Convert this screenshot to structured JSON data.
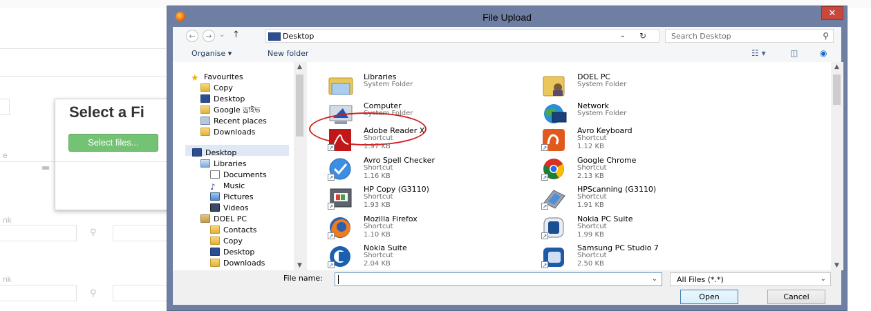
{
  "background": {
    "modal_title": "Select a Fi",
    "select_button": "Select files...",
    "side_labels": [
      "e",
      "nk",
      "nk"
    ]
  },
  "dialog": {
    "title": "File Upload",
    "close_glyph": "✕",
    "address": {
      "location": "Desktop"
    },
    "search": {
      "placeholder": "Search Desktop"
    },
    "toolbar": {
      "organise": "Organise ▾",
      "new_folder": "New folder"
    },
    "nav_tree": [
      {
        "label": "Favourites",
        "icon": "star-icon"
      },
      {
        "label": "Copy",
        "icon": "folder-icon"
      },
      {
        "label": "Desktop",
        "icon": "desktop-icon"
      },
      {
        "label": "Google ড্রাইভ",
        "icon": "drive-folder-icon"
      },
      {
        "label": "Recent places",
        "icon": "recent-places-icon"
      },
      {
        "label": "Downloads",
        "icon": "downloads-icon"
      },
      {
        "label": "Desktop",
        "icon": "desktop-icon"
      },
      {
        "label": "Libraries",
        "icon": "libraries-icon"
      },
      {
        "label": "Documents",
        "icon": "documents-icon"
      },
      {
        "label": "Music",
        "icon": "music-icon"
      },
      {
        "label": "Pictures",
        "icon": "pictures-icon"
      },
      {
        "label": "Videos",
        "icon": "videos-icon"
      },
      {
        "label": "DOEL PC",
        "icon": "user-folder-icon"
      },
      {
        "label": "Contacts",
        "icon": "contacts-icon"
      },
      {
        "label": "Copy",
        "icon": "folder-icon"
      },
      {
        "label": "Desktop",
        "icon": "desktop-icon"
      },
      {
        "label": "Downloads",
        "icon": "downloads-icon"
      }
    ],
    "files": [
      {
        "name": "Libraries",
        "type": "System Folder",
        "size": ""
      },
      {
        "name": "DOEL PC",
        "type": "System Folder",
        "size": ""
      },
      {
        "name": "Computer",
        "type": "System Folder",
        "size": ""
      },
      {
        "name": "Network",
        "type": "System Folder",
        "size": ""
      },
      {
        "name": "Adobe Reader X",
        "type": "Shortcut",
        "size": "1.97 KB"
      },
      {
        "name": "Avro Keyboard",
        "type": "Shortcut",
        "size": "1.12 KB"
      },
      {
        "name": "Avro Spell Checker",
        "type": "Shortcut",
        "size": "1.16 KB"
      },
      {
        "name": "Google Chrome",
        "type": "Shortcut",
        "size": "2.13 KB"
      },
      {
        "name": "HP Copy (G3110)",
        "type": "Shortcut",
        "size": "1.93 KB"
      },
      {
        "name": "HPScanning (G3110)",
        "type": "Shortcut",
        "size": "1.91 KB"
      },
      {
        "name": "Mozilla Firefox",
        "type": "Shortcut",
        "size": "1.10 KB"
      },
      {
        "name": "Nokia PC Suite",
        "type": "Shortcut",
        "size": "1.99 KB"
      },
      {
        "name": "Nokia Suite",
        "type": "Shortcut",
        "size": "2.04 KB"
      },
      {
        "name": "Samsung PC Studio 7",
        "type": "Shortcut",
        "size": "2.50 KB"
      }
    ],
    "file_name": {
      "label": "File name:",
      "value": ""
    },
    "file_type": "All Files (*.*)",
    "buttons": {
      "open": "Open",
      "cancel": "Cancel"
    }
  }
}
